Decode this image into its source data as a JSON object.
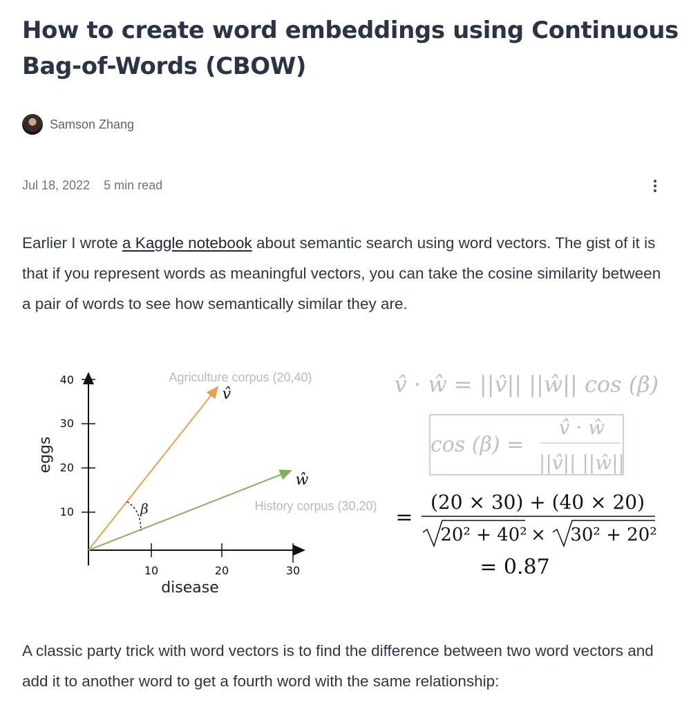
{
  "article": {
    "title": "How to create word embeddings using Continuous Bag-of-Words (CBOW)",
    "author": "Samson Zhang",
    "date": "Jul 18, 2022",
    "read_time": "5 min read"
  },
  "paragraph1": {
    "before_link": "Earlier I wrote ",
    "link_text": "a Kaggle notebook",
    "after_link": " about semantic search using word vectors. The gist of it is that if you represent words as meaningful vectors, you can take the cosine similarity between a pair of words to see how semantically similar they are."
  },
  "paragraph2": {
    "text": "A classic party trick with word vectors is to find the difference between two word vectors and add it to another word to get a fourth word with the same relationship:"
  },
  "figure": {
    "xlabel": "disease",
    "ylabel": "eggs",
    "x_ticks": [
      "10",
      "20",
      "30"
    ],
    "y_ticks": [
      "10",
      "20",
      "30",
      "40"
    ],
    "vector_v_label": "Agriculture corpus (20,40)",
    "vector_w_label": "History corpus (30,20)",
    "v_symbol": "v̂",
    "w_symbol": "ŵ",
    "angle_symbol": "β",
    "equation1": "v̂ · ŵ = ||v̂|| ||ŵ|| cos (β)",
    "equation2_lhs": "cos (β) =",
    "equation2_num": "v̂ · ŵ",
    "equation2_den": "||v̂|| ||ŵ||",
    "equation3_eq": "=",
    "equation3_num": "(20 × 30) + (40 × 20)",
    "equation3_den_a": "20² + 40²",
    "equation3_times": "×",
    "equation3_den_b": "30² + 20²",
    "equation4": "= 0.87",
    "colors": {
      "v_vector": "#e4a24f",
      "w_vector": "#7fb15a",
      "box": "#e7c7cc",
      "faded_text": "#b9b9b9"
    }
  }
}
